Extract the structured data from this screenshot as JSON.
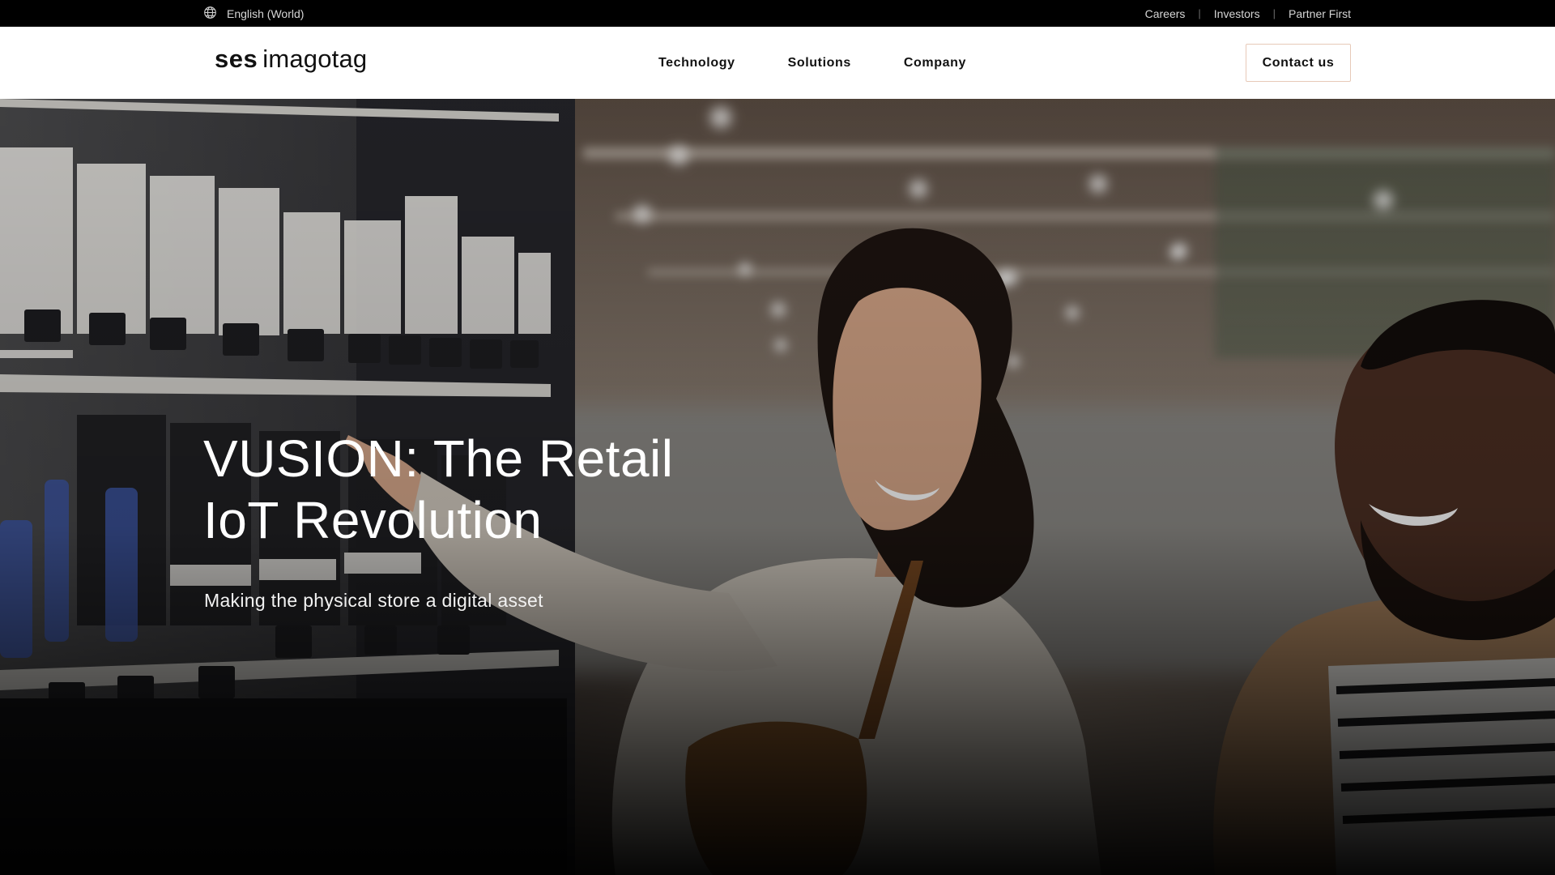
{
  "topbar": {
    "language": "English (World)",
    "links": [
      "Careers",
      "Investors",
      "Partner First"
    ]
  },
  "header": {
    "logo": {
      "primary": "ses",
      "secondary": "imagotag"
    },
    "nav": [
      "Technology",
      "Solutions",
      "Company"
    ],
    "cta": "Contact us"
  },
  "hero": {
    "title_line1": "VUSION: The Retail",
    "title_line2": "IoT Revolution",
    "subtitle": "Making the physical store a digital asset",
    "image": "shoppers-pointing-at-electronic-shelf-labels"
  },
  "colors": {
    "topbar_bg": "#000000",
    "header_bg": "#ffffff",
    "cta_border": "#e7c9b8",
    "hero_text": "#ffffff"
  },
  "icons": [
    "globe-icon"
  ]
}
